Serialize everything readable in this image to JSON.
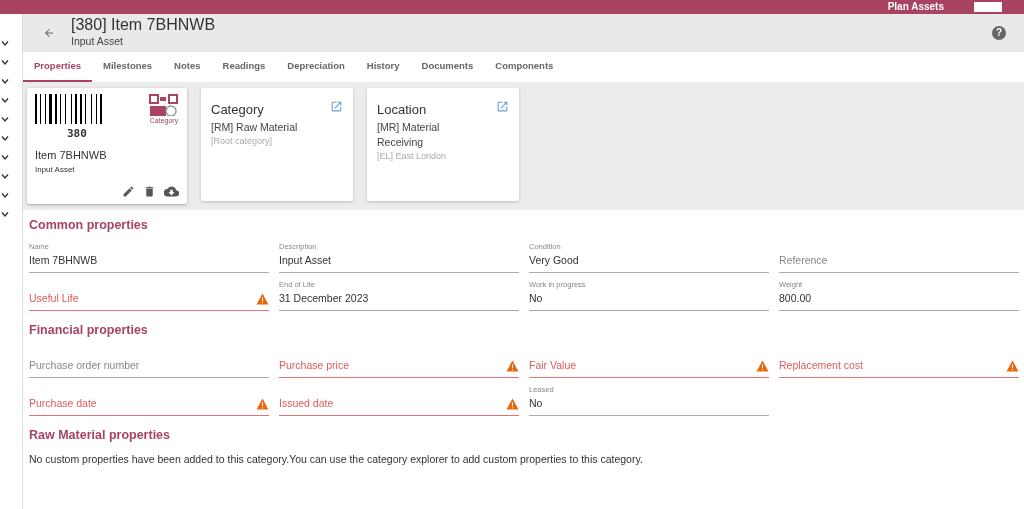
{
  "top_bar": {
    "title": "Plan Assets"
  },
  "sidebar": {
    "items": [
      {
        "expanded": false
      },
      {
        "expanded": false
      },
      {
        "expanded": false
      },
      {
        "expanded": false
      },
      {
        "expanded": false
      },
      {
        "expanded": false
      },
      {
        "expanded": false
      },
      {
        "expanded": false
      },
      {
        "expanded": false
      },
      {
        "expanded": false
      }
    ]
  },
  "header": {
    "title": "[380] Item 7BHNWB",
    "subtitle": "Input Asset",
    "help": "?"
  },
  "tabs": [
    {
      "label": "Properties",
      "selected": true
    },
    {
      "label": "Milestones",
      "selected": false
    },
    {
      "label": "Notes",
      "selected": false
    },
    {
      "label": "Readings",
      "selected": false
    },
    {
      "label": "Depreciation",
      "selected": false
    },
    {
      "label": "History",
      "selected": false
    },
    {
      "label": "Documents",
      "selected": false
    },
    {
      "label": "Components",
      "selected": false
    }
  ],
  "asset_card": {
    "barcode_number": "380",
    "qr_caption": "Category",
    "name": "Item 7BHNWB",
    "type": "Input Asset"
  },
  "info_cards": [
    {
      "title": "Category",
      "value": "[RM] Raw Material",
      "detail": "[Root category]"
    },
    {
      "title": "Location",
      "value": "[MR] Material Receiving",
      "detail": "[EL] East London"
    }
  ],
  "sections": [
    {
      "title": "Common properties",
      "fields": [
        {
          "label": "Name",
          "value": "Item 7BHNWB",
          "error": false
        },
        {
          "label": "Description",
          "value": "Input Asset",
          "error": false
        },
        {
          "label": "Condition",
          "value": "Very Good",
          "error": false
        },
        {
          "placeholder": "Reference",
          "error": false
        },
        {
          "placeholder": "Useful Life",
          "error": true
        },
        {
          "label": "End of Life",
          "value": "31 December 2023",
          "error": false
        },
        {
          "label": "Work in progress",
          "value": "No",
          "error": false
        },
        {
          "label": "Weight",
          "value": "800.00",
          "error": false
        }
      ]
    },
    {
      "title": "Financial properties",
      "fields": [
        {
          "placeholder": "Purchase order number",
          "error": false
        },
        {
          "placeholder": "Purchase price",
          "error": true
        },
        {
          "placeholder": "Fair Value",
          "error": true
        },
        {
          "placeholder": "Replacement cost",
          "error": true
        },
        {
          "placeholder": "Purchase date",
          "error": true
        },
        {
          "placeholder": "Issued date",
          "error": true
        },
        {
          "label": "Leased",
          "value": "No",
          "error": false
        }
      ]
    },
    {
      "title": "Raw Material properties",
      "message": "No custom properties have been added to this category.You can use the category explorer to add custom properties to this category."
    }
  ]
}
